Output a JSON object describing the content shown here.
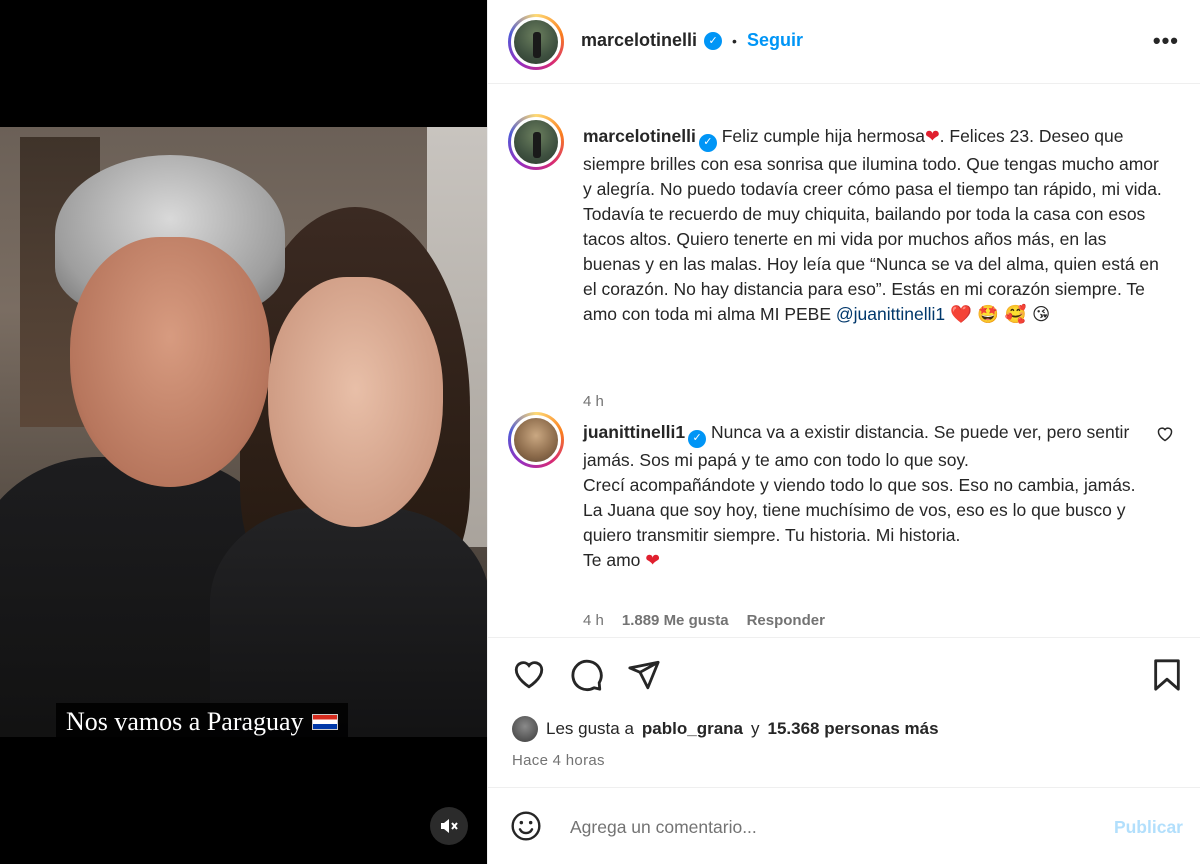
{
  "post": {
    "author": "marcelotinelli",
    "follow_label": "Seguir",
    "separator": "•",
    "more_label": "•••"
  },
  "media": {
    "overlay_text": "Nos vamos a Paraguay",
    "flag_icon": "paraguay-flag-icon",
    "mute_icon": "speaker-muted-icon"
  },
  "caption": {
    "username": "marcelotinelli",
    "text_part1": "Feliz cumple hija hermosa",
    "text_part2": ". Felices 23. Deseo que siempre brilles con esa sonrisa que ilumina todo. Que tengas mucho amor y alegría. No puedo todavía creer cómo pasa el tiempo tan rápido, mi vida. Todavía te recuerdo de muy chiquita, bailando por toda la casa con esos tacos altos. Quiero tenerte en mi vida por muchos años más, en las buenas y en las malas. Hoy leía que “Nunca se va del alma, quien está en el corazón. No hay distancia para eso”. Estás en mi corazón siempre. Te amo con toda mi alma MI PEBE ",
    "mention": "@juanittinelli1",
    "trailing_emoji": "❤️ 🤩 🥰 😘",
    "time": "4 h"
  },
  "reply": {
    "username": "juanittinelli1",
    "line1": "Nunca va a existir distancia. Se puede ver, pero sentir jamás. Sos mi papá y te amo con todo lo que soy.",
    "line2": "Crecí acompañándote y viendo todo lo que sos. Eso no cambia, jamás.",
    "line3": "La Juana que soy hoy, tiene muchísimo de vos, eso es lo que busco y quiero transmitir siempre. Tu historia. Mi historia.",
    "line4": "Te amo",
    "line4_emoji": "❤️",
    "time": "4 h",
    "likes": "1.889 Me gusta",
    "reply_label": "Responder"
  },
  "actions": {
    "likes_prefix": "Les gusta a",
    "likes_user": "pablo_grana",
    "likes_mid": "y",
    "likes_count": "15.368 personas más",
    "time_ago": "Hace 4 horas"
  },
  "composer": {
    "placeholder": "Agrega un comentario...",
    "post_label": "Publicar"
  },
  "colors": {
    "link_blue": "#0095f6",
    "mention_blue": "#00376b",
    "secondary_text": "#737373",
    "publish_disabled": "#b2dffc"
  }
}
